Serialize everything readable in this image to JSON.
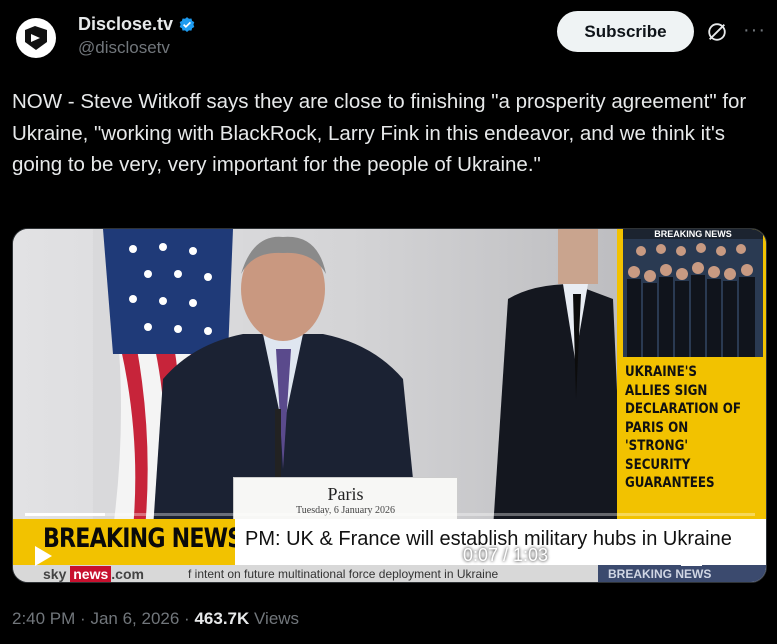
{
  "account": {
    "display_name": "Disclose.tv",
    "handle": "@disclosetv",
    "subscribe_label": "Subscribe"
  },
  "tweet": {
    "text": "NOW - Steve Witkoff says they are close to finishing \"a prosperity agreement\" for Ukraine, \"working with BlackRock, Larry Fink in this endeavor, and we think it's going to be very, very important for the people of Ukraine.\""
  },
  "video": {
    "sign_city": "Paris",
    "sign_date": "Tuesday, 6 January 2026",
    "side_panel_heading": "BREAKING NEWS",
    "side_headline": "Ukraine's allies sign declaration of Paris on 'strong' security guarantees",
    "breaking_label": "BREAKING NEWS",
    "ticker_text": "PM: UK & France will establish military hubs in Ukraine",
    "sky_prefix": "sky",
    "sky_news": "news",
    "sky_suffix": ".com",
    "strip_text": "f intent on future multinational force deployment in Ukraine",
    "strip_right_text": "BREAKING NEWS",
    "time": "0:07 / 1:03",
    "progress": 0.11
  },
  "meta": {
    "time": "2:40 PM",
    "separator": "·",
    "date": "Jan 6, 2026",
    "views_count": "463.7K",
    "views_label": "Views"
  },
  "colors": {
    "accent_yellow": "#f2c200",
    "verified_blue": "#1d9bf0"
  },
  "icons": [
    "play-icon",
    "volume-icon",
    "gear-icon",
    "pip-icon",
    "fullscreen-icon",
    "verified-badge-icon",
    "grok-icon",
    "more-icon"
  ]
}
